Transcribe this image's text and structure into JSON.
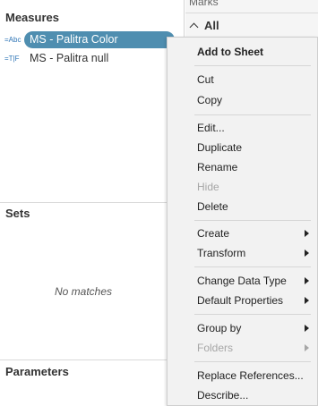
{
  "left_pane": {
    "measures_title": "Measures",
    "fields": [
      {
        "icon": "=Abc",
        "label": "MS - Palitra Color",
        "selected": true
      },
      {
        "icon": "=T|F",
        "label": "MS - Palitra null",
        "selected": false
      }
    ],
    "sets_title": "Sets",
    "sets_empty": "No matches",
    "parameters_title": "Parameters"
  },
  "marks_pane": {
    "header": "Marks",
    "all_label": "All"
  },
  "context_menu": {
    "items": [
      {
        "label": "Add to Sheet",
        "bold": true,
        "disabled": false,
        "submenu": false
      },
      {
        "label": "Cut",
        "bold": false,
        "disabled": false,
        "submenu": false
      },
      {
        "label": "Copy",
        "bold": false,
        "disabled": false,
        "submenu": false
      },
      {
        "label": "Edit...",
        "bold": false,
        "disabled": false,
        "submenu": false
      },
      {
        "label": "Duplicate",
        "bold": false,
        "disabled": false,
        "submenu": false
      },
      {
        "label": "Rename",
        "bold": false,
        "disabled": false,
        "submenu": false
      },
      {
        "label": "Hide",
        "bold": false,
        "disabled": true,
        "submenu": false
      },
      {
        "label": "Delete",
        "bold": false,
        "disabled": false,
        "submenu": false
      },
      {
        "label": "Create",
        "bold": false,
        "disabled": false,
        "submenu": true
      },
      {
        "label": "Transform",
        "bold": false,
        "disabled": false,
        "submenu": true
      },
      {
        "label": "Change Data Type",
        "bold": false,
        "disabled": false,
        "submenu": true
      },
      {
        "label": "Default Properties",
        "bold": false,
        "disabled": false,
        "submenu": true
      },
      {
        "label": "Group by",
        "bold": false,
        "disabled": false,
        "submenu": true
      },
      {
        "label": "Folders",
        "bold": false,
        "disabled": true,
        "submenu": true
      },
      {
        "label": "Replace References...",
        "bold": false,
        "disabled": false,
        "submenu": false
      },
      {
        "label": "Describe...",
        "bold": false,
        "disabled": false,
        "submenu": false
      }
    ]
  },
  "colors": {
    "selected_field_bg": "#4f8eb0",
    "icon_blue": "#2e75b6",
    "menu_bg": "#f2f2f2",
    "disabled_text": "#a6a6a6"
  }
}
